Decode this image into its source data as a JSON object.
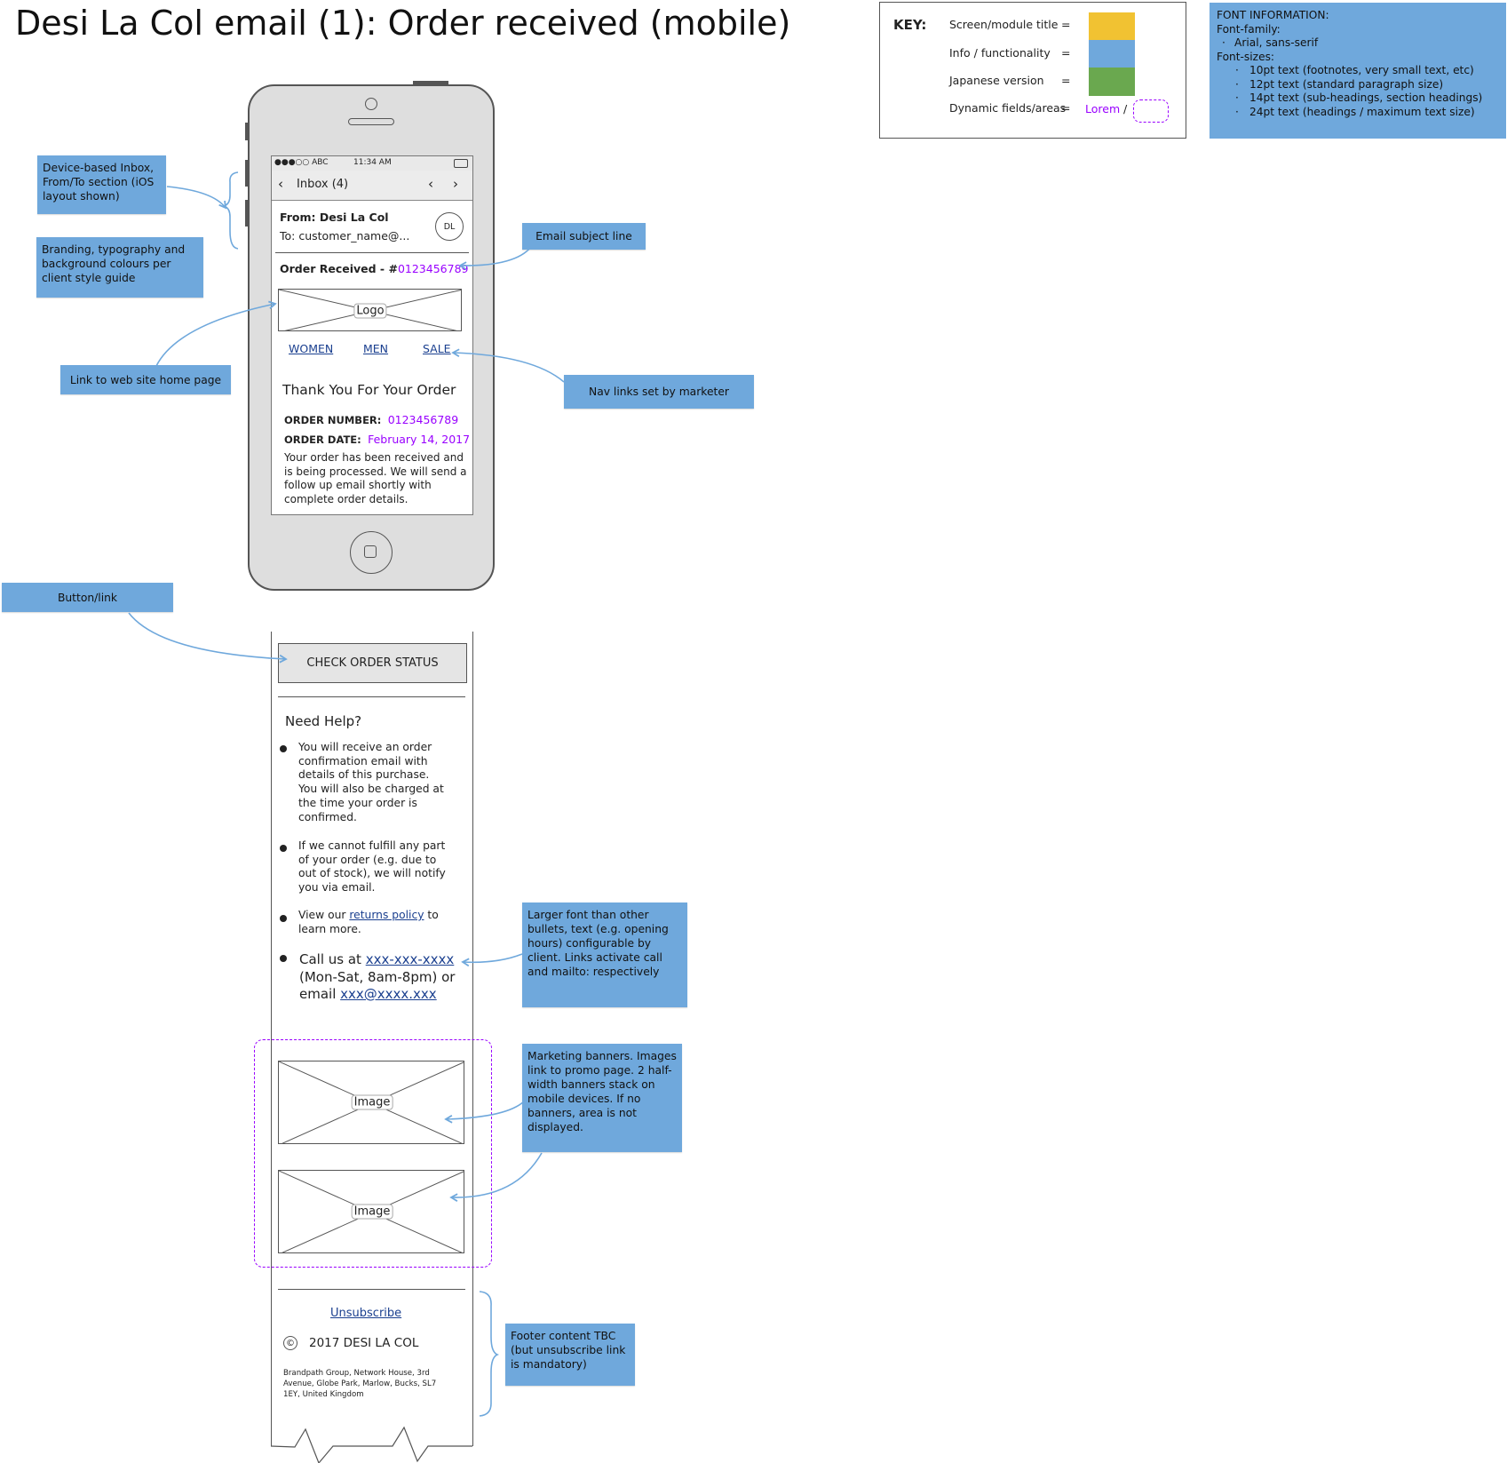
{
  "title": "Desi La Col email (1): Order received (mobile)",
  "key": {
    "label": "KEY:",
    "rows": [
      {
        "label": "Screen/module title",
        "eq": "=",
        "swatch": "#f1c232"
      },
      {
        "label": "Info / functionality",
        "eq": "=",
        "swatch": "#6fa8dc"
      },
      {
        "label": "Japanese version",
        "eq": "=",
        "swatch": "#6aa84f"
      },
      {
        "label": "Dynamic fields/areas",
        "eq": "=",
        "sample": "Lorem",
        "sep": "/"
      }
    ]
  },
  "font_info": {
    "heading": "FONT INFORMATION:",
    "family_label": "Font-family:",
    "family": "Arial, sans-serif",
    "sizes_label": "Font-sizes:",
    "sizes": [
      "10pt text (footnotes, very small text, etc)",
      "12pt text (standard paragraph size)",
      "14pt text (sub-headings, section headings)",
      "24pt text (headings / maximum text size)"
    ]
  },
  "notes": {
    "device_inbox": "Device-based Inbox, From/To section (iOS layout shown)",
    "branding": "Branding, typography and background colours per client style guide",
    "home_link": "Link to web site home page",
    "subject_line": "Email subject line",
    "nav_links": "Nav links set by marketer",
    "button_link": "Button/link",
    "larger_font": "Larger font than other bullets, text (e.g. opening hours) configurable by client. Links activate call and mailto: respectively",
    "banners": "Marketing banners. Images link to promo page. 2 half-width banners stack on mobile devices. If no banners, area is not displayed.",
    "footer": "Footer content TBC (but unsubscribe link is mandatory)"
  },
  "email": {
    "status_carrier": "●●●○○ ABC",
    "status_time": "11:34 AM",
    "inbox_label": "Inbox (4)",
    "from": "From: Desi La Col",
    "to": "To: customer_name@...",
    "avatar": "DL",
    "subject_prefix": "Order Received - #",
    "subject_number": "0123456789",
    "logo_label": "Logo",
    "nav": [
      "WOMEN",
      "MEN",
      "SALE"
    ],
    "heading": "Thank You For Your Order",
    "order_number_label": "ORDER NUMBER:",
    "order_number": "0123456789",
    "order_date_label": "ORDER DATE:",
    "order_date": "February 14, 2017",
    "intro": "Your order has been received and is being processed. We will send a follow up email shortly with complete order details.",
    "button": "CHECK ORDER STATUS",
    "help_heading": "Need Help?",
    "bullets": {
      "b1": "You will receive an order confirmation email with details of this purchase. You will also be charged at the time your order is confirmed.",
      "b2": "If we cannot fulfill any part of your order (e.g. due to out of stock), we will notify you via email.",
      "b3_pre": "View our ",
      "b3_link": "returns policy",
      "b3_post": " to learn more.",
      "b4_pre": "Call us at ",
      "b4_phone": "xxx-xxx-xxxx",
      "b4_mid": " (Mon-Sat, 8am-8pm) or email ",
      "b4_email": "xxx@xxxx.xxx"
    },
    "banner_label": "Image",
    "unsubscribe": "Unsubscribe",
    "copyright_symbol": "©",
    "copyright": "2017 DESI LA COL",
    "address": "Brandpath Group, Network House, 3rd Avenue, Globe Park, Marlow, Bucks, SL7 1EY, United Kingdom"
  }
}
